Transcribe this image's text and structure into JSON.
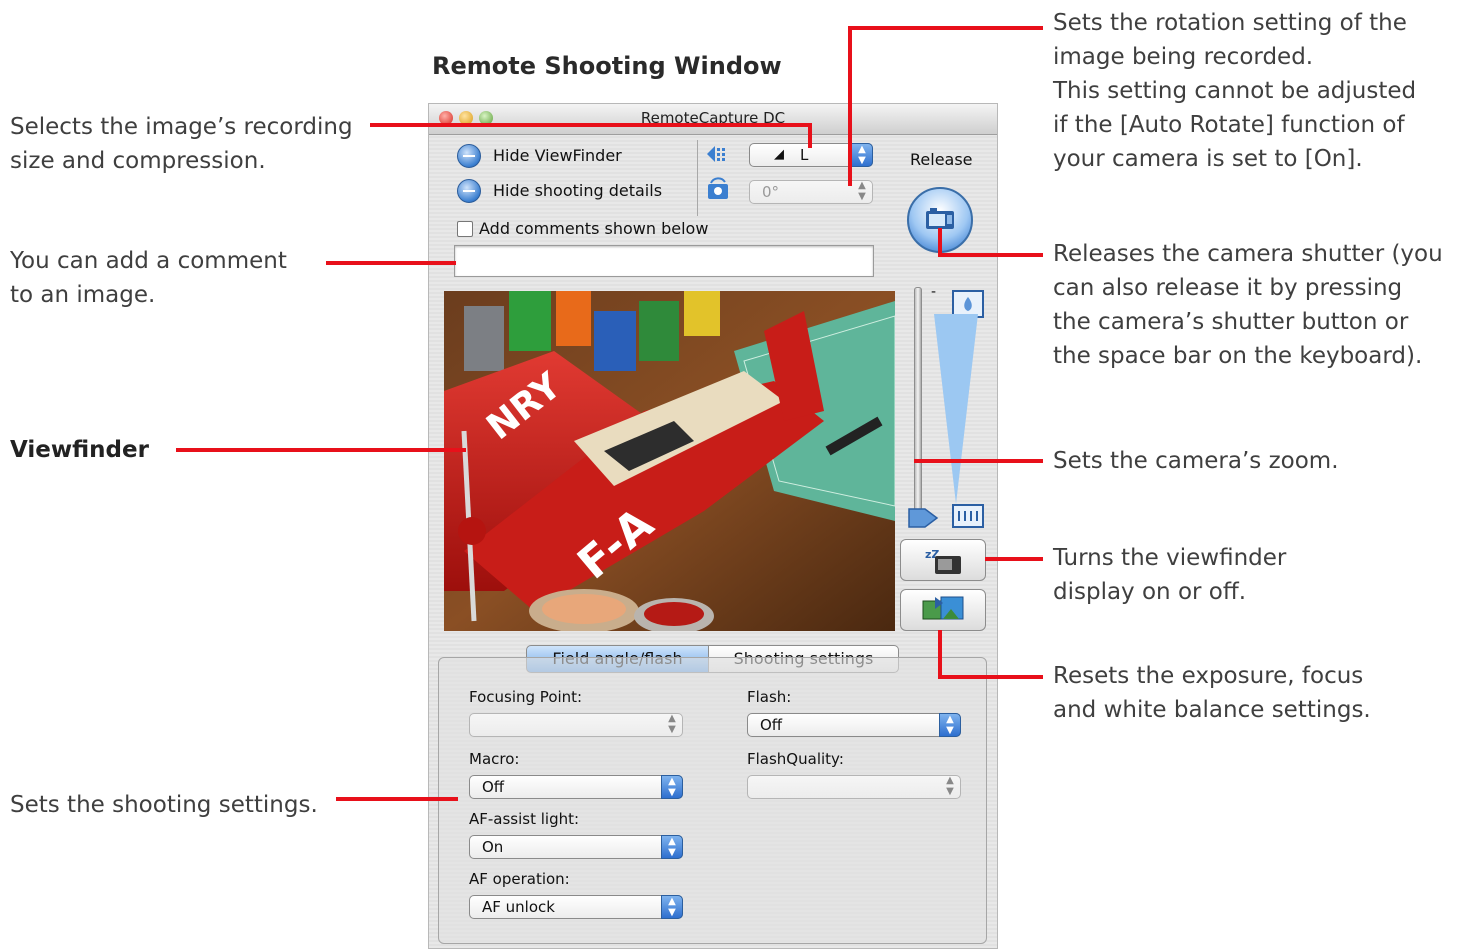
{
  "section_title": "Remote Shooting Window",
  "callouts": {
    "recording_size": [
      "Selects the image’s recording",
      "size and compression."
    ],
    "comment": [
      "You can add a comment",
      "to an image."
    ],
    "viewfinder": "Viewfinder",
    "shooting_settings": "Sets the shooting settings.",
    "rotation": [
      "Sets the rotation setting of the",
      "image being recorded.",
      "This setting cannot be adjusted",
      "if the [Auto Rotate] function of",
      "your camera is set to [On]."
    ],
    "release": [
      "Releases the camera shutter (you",
      "can also release it by pressing",
      "the camera’s shutter button or",
      "the space bar on the keyboard)."
    ],
    "zoom": "Sets the camera’s zoom.",
    "viewfinder_toggle": [
      "Turns the viewfinder",
      "display on or off."
    ],
    "reset": [
      "Resets the exposure, focus",
      "and white balance settings."
    ]
  },
  "window": {
    "title": "RemoteCapture DC",
    "hide_viewfinder": "Hide ViewFinder",
    "hide_shooting_details": "Hide shooting details",
    "size_value": "L",
    "rotation_value": "0°",
    "release_label": "Release",
    "add_comments_label": "Add comments shown below",
    "comment_value": "",
    "tabs": [
      "Field angle/flash",
      "Shooting settings"
    ],
    "fields": {
      "focusing_point": {
        "label": "Focusing Point:",
        "value": ""
      },
      "flash": {
        "label": "Flash:",
        "value": "Off"
      },
      "macro": {
        "label": "Macro:",
        "value": "Off"
      },
      "flash_quality": {
        "label": "FlashQuality:",
        "value": ""
      },
      "af_assist": {
        "label": "AF-assist light:",
        "value": "On"
      },
      "af_operation": {
        "label": "AF operation:",
        "value": "AF unlock"
      }
    },
    "zoom_min": "-",
    "colors": {
      "accent": "#3b7fd0",
      "callout_line": "#e8101a"
    }
  }
}
